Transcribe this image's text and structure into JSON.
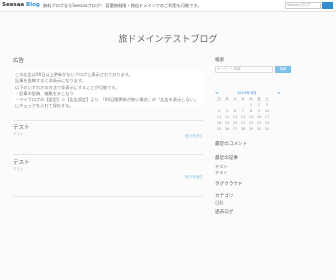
{
  "topbar": {
    "logo_part1": "Seesaa",
    "logo_part2": "Blog",
    "notice": "無料ブログならSeesaaブログ！ 容量無制限・独自ドメインでのご利用も可能です。",
    "search_placeholder": "Seesaaブログ"
  },
  "site": {
    "title": "旅ドメインテストブログ"
  },
  "ad": {
    "title": "広告",
    "date": "",
    "lines": [
      "この広告は90日以上更新がないブログに表示されております。",
      "記事を投稿すると非表示になります。",
      "以下のいずれかの方法で非表示にすることが可能です。",
      "・記事の投稿、編集をおこなう",
      "・マイブログの【設定】＞【広告設定】より、「60日間更新が無い場合」の「広告を表示しない」にチェックを入れて保存する。"
    ]
  },
  "posts": [
    {
      "title": "テスト",
      "date": "",
      "body": "テスト",
      "more": "続きを読む"
    },
    {
      "title": "テスト",
      "date": "",
      "body": "テスト",
      "more": "続きを読む"
    }
  ],
  "sidebar": {
    "search_heading": "検索",
    "search_placeholder": "キーワード検索",
    "search_button": "検索",
    "calendar": {
      "title": "2019年 8月",
      "headers": [
        "日",
        "月",
        "火",
        "水",
        "木",
        "金",
        "土"
      ],
      "rows": [
        [
          "",
          "",
          "",
          "",
          "1",
          "2",
          "3"
        ],
        [
          "4",
          "5",
          "6",
          "7",
          "8",
          "9",
          "10"
        ],
        [
          "11",
          "12",
          "13",
          "14",
          "15",
          "16",
          "17"
        ],
        [
          "18",
          "19",
          "20",
          "21",
          "22",
          "23",
          "24"
        ],
        [
          "25",
          "26",
          "27",
          "28",
          "29",
          "30",
          "31"
        ]
      ]
    },
    "recent_comments_heading": "最近のコメント",
    "recent_posts_heading": "最近の記事",
    "recent_posts": [
      "テスト",
      "テスト"
    ],
    "tagcloud_heading": "タグクラウド",
    "category_heading": "カテゴリ",
    "category_item": "日記",
    "archive_heading": "過去ログ"
  },
  "colors": {
    "accent": "#2f8fd1",
    "link": "#78bde6"
  }
}
